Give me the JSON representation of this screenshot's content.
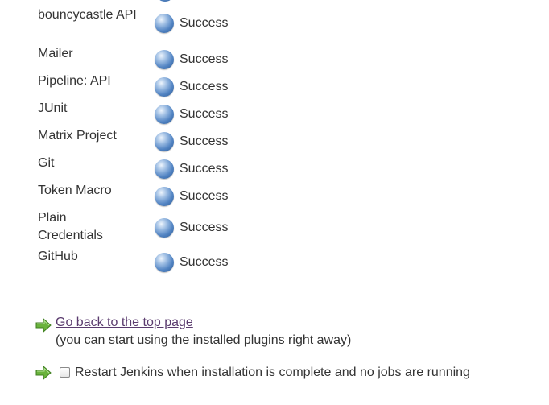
{
  "plugins": [
    {
      "name": "bouncycastle API",
      "status": "Success"
    },
    {
      "name": "Mailer",
      "status": "Success"
    },
    {
      "name": "Pipeline: API",
      "status": "Success"
    },
    {
      "name": "JUnit",
      "status": "Success"
    },
    {
      "name": "Matrix Project",
      "status": "Success"
    },
    {
      "name": "Git",
      "status": "Success"
    },
    {
      "name": "Token Macro",
      "status": "Success"
    },
    {
      "name": "Plain Credentials",
      "status": "Success"
    },
    {
      "name": "GitHub",
      "status": "Success"
    }
  ],
  "actions": {
    "go_back_link": "Go back to the top page",
    "go_back_note": "(you can start using the installed plugins right away)",
    "restart_label": "Restart Jenkins when installation is complete and no jobs are running",
    "restart_checked": false
  },
  "icons": {
    "status_ball": "blue-ball-icon",
    "action_arrow": "green-arrow-icon"
  },
  "colors": {
    "status_ball": "#5284c3",
    "link": "#5a3b6e",
    "arrow": "#6ab33c"
  }
}
